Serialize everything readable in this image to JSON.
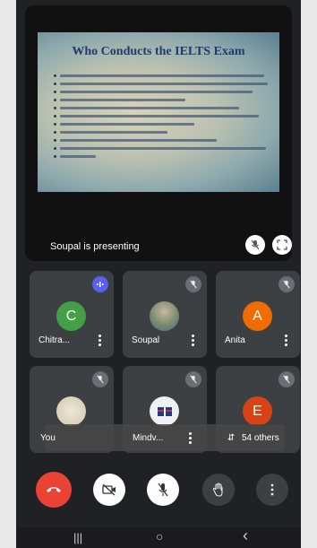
{
  "presentation": {
    "slide_title": "Who Conducts the IELTS Exam",
    "bullet_count_visible": 11,
    "presenter_text": "Soupal is presenting"
  },
  "participants": [
    {
      "name": "Chitra...",
      "initial": "C",
      "avatar_color": "#43a047",
      "status": "speaking"
    },
    {
      "name": "Soupal",
      "initial": "",
      "avatar_color": "#7a8a70",
      "status": "muted"
    },
    {
      "name": "Anita",
      "initial": "A",
      "avatar_color": "#ef6c00",
      "status": "muted"
    },
    {
      "name": "You",
      "initial": "",
      "avatar_color": "#d8d2c0",
      "status": "muted"
    },
    {
      "name": "Mindv...",
      "initial": "",
      "avatar_color": "#f0f0f0",
      "status": "muted"
    },
    {
      "name": "54 others",
      "initial": "E",
      "avatar_color": "#d84315",
      "status": "muted"
    }
  ],
  "controls": {
    "end_call_color": "#ea4335",
    "icons": [
      "end-call-icon",
      "camera-off-icon",
      "mic-off-icon",
      "raise-hand-icon",
      "more-options-icon"
    ]
  },
  "system_nav": {
    "recents": "|||",
    "home": "○",
    "back": "‹"
  },
  "colors": {
    "background": "#202124",
    "tile": "#3c4043",
    "speaking_badge": "#5b5ef0"
  }
}
